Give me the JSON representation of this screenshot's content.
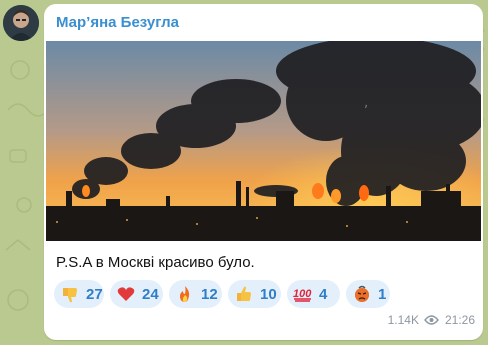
{
  "message": {
    "author": "Мар’яна Безугла",
    "text": "P.S.A в Москві красиво було.",
    "views": "1.14K",
    "time": "21:26",
    "reactions": [
      {
        "emoji": "thumbs-down",
        "count": "27"
      },
      {
        "emoji": "red-heart",
        "count": "24"
      },
      {
        "emoji": "fire",
        "count": "12"
      },
      {
        "emoji": "thumbs-up",
        "count": "10"
      },
      {
        "emoji": "hundred-points",
        "count": "4"
      },
      {
        "emoji": "angry-face",
        "count": "1"
      }
    ]
  },
  "colors": {
    "wallpaper": "#b9c98f",
    "author": "#3a8fd1",
    "reaction_bg": "#e3f0fb",
    "reaction_text": "#2f7ec7",
    "meta": "#8d97a0"
  }
}
